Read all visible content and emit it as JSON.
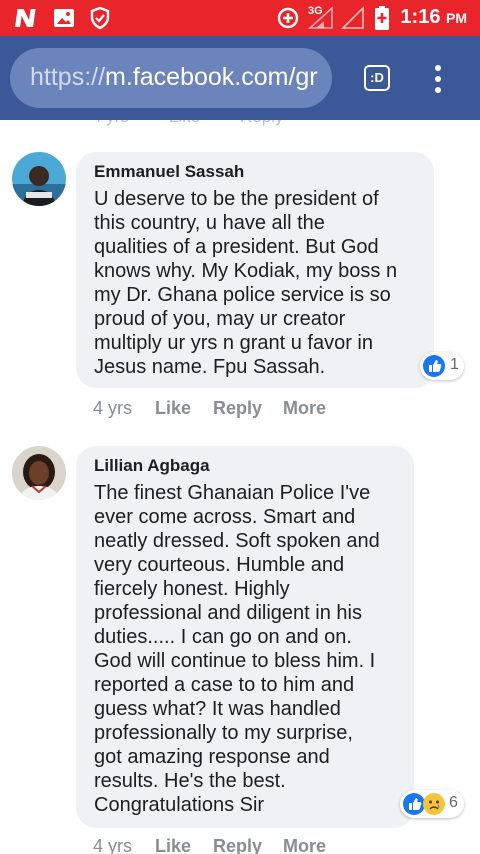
{
  "status_bar": {
    "time": "1:16",
    "ampm": "PM",
    "network": "3G",
    "icons": [
      "netflix-icon",
      "gallery-icon",
      "shield-icon",
      "data-saver-icon",
      "signal-icon",
      "battery-icon"
    ],
    "color": "#e8252a"
  },
  "browser": {
    "url_scheme": "https://",
    "url_host": "m.facebook.com/gr",
    "tabs_label": ":D",
    "color": "#3b5998"
  },
  "comments": [
    {
      "author": "Emmanuel Sassah",
      "lines": [
        "U deserve to be the president of",
        "this country, u have all the",
        "qualities of a president. But God",
        "knows why. My Kodiak, my boss n",
        "my Dr. Ghana police service is so",
        "proud of you, may ur creator",
        "multiply ur yrs n grant u favor in",
        "Jesus name. Fpu Sassah."
      ],
      "reaction_count": "1",
      "time": "4 yrs",
      "like": "Like",
      "reply": "Reply",
      "more": "More"
    },
    {
      "author": "Lillian Agbaga",
      "lines": [
        "The finest Ghanaian Police I've",
        "ever come across. Smart and",
        "neatly dressed. Soft spoken and",
        "very courteous. Humble and",
        "fiercely honest. Highly",
        "professional and diligent in his",
        "duties..... I can go on and on.",
        "God will continue to bless him. I",
        "reported a case to to him and",
        "guess what? It was handled",
        "professionally to my surprise,",
        "got amazing response and",
        "results. He's the best.",
        "Congratulations Sir"
      ],
      "reaction_count": "6",
      "time": "4 yrs",
      "like": "Like",
      "reply": "Reply",
      "more": "More"
    }
  ]
}
